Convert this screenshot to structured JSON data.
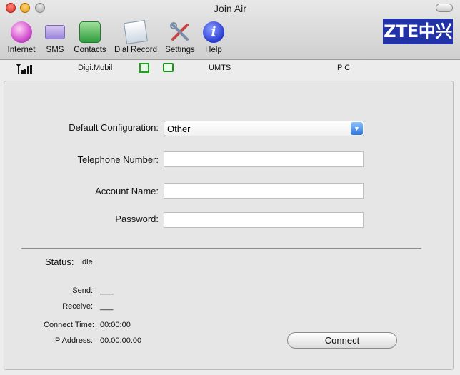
{
  "window": {
    "title": "Join Air"
  },
  "toolbar": {
    "items": [
      {
        "label": "Internet",
        "icon": "globe-icon"
      },
      {
        "label": "SMS",
        "icon": "envelope-icon"
      },
      {
        "label": "Contacts",
        "icon": "phonebook-icon"
      },
      {
        "label": "Dial Record",
        "icon": "call-log-icon"
      },
      {
        "label": "Settings",
        "icon": "tools-icon"
      },
      {
        "label": "Help",
        "icon": "info-icon"
      }
    ],
    "logo_text": "ZTE中兴"
  },
  "status_strip": {
    "operator": "Digi.Mobil",
    "network": "UMTS",
    "mode": "P C"
  },
  "form": {
    "default_configuration": {
      "label": "Default Configuration:",
      "value": "Other"
    },
    "telephone_number": {
      "label": "Telephone Number:",
      "value": ""
    },
    "account_name": {
      "label": "Account Name:",
      "value": ""
    },
    "password": {
      "label": "Password:",
      "value": ""
    }
  },
  "connection": {
    "status_label": "Status:",
    "status_value": "Idle",
    "send_label": "Send:",
    "send_value": "___",
    "receive_label": "Receive:",
    "receive_value": "___",
    "connect_time_label": "Connect Time:",
    "connect_time_value": "00:00:00",
    "ip_label": "IP Address:",
    "ip_value": "00.00.00.00",
    "connect_button": "Connect"
  },
  "colors": {
    "logo_blue": "#2233a8",
    "indicator_green": "#1fa221",
    "select_arrow": "#2f73d6"
  }
}
